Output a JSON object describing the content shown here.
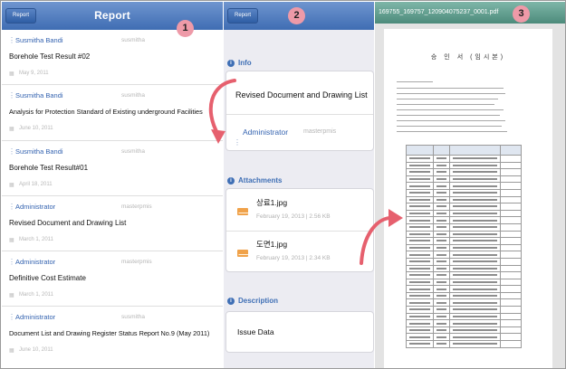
{
  "panel1": {
    "back_label": "Report",
    "title": "Report",
    "badge": "1",
    "items": [
      {
        "user": "Susmitha Bandi",
        "handle": "susmitha",
        "title": "Borehole Test Result #02",
        "date": "May 9, 2011"
      },
      {
        "user": "Susmitha Bandi",
        "handle": "susmitha",
        "title": "Analysis for Protection Standard of Existing underground Facilities",
        "date": "June 10, 2011"
      },
      {
        "user": "Susmitha Bandi",
        "handle": "susmitha",
        "title": "Borehole Test Result#01",
        "date": "April 18, 2011"
      },
      {
        "user": "Administrator",
        "handle": "masterpmis",
        "title": "Revised Document and Drawing List",
        "date": "March 1, 2011"
      },
      {
        "user": "Administrator",
        "handle": "masterpmis",
        "title": "Definitive Cost Estimate",
        "date": "March 1, 2011"
      },
      {
        "user": "Administrator",
        "handle": "susmitha",
        "title": "Document List and Drawing Register Status Report No.9 (May 2011)",
        "date": "June 10, 2011"
      }
    ]
  },
  "panel2": {
    "back_label": "Report",
    "badge": "2",
    "info_header": "Info",
    "doc_title": "Revised Document and Drawing List",
    "author": "Administrator",
    "author_handle": "masterpmis",
    "attachments_header": "Attachments",
    "attachments": [
      {
        "name": "상료1.jpg",
        "meta": "February 19, 2013 | 2.56 KB"
      },
      {
        "name": "도면1.jpg",
        "meta": "February 19, 2013 | 2.34 KB"
      }
    ],
    "description_header": "Description",
    "description": "Issue Data"
  },
  "panel3": {
    "filename": "169755_169757_120904075237_0001.pdf",
    "badge": "3",
    "doc_heading": "승 인 서 (임시본)"
  },
  "colors": {
    "nav_blue": "#4f7cc0",
    "link_blue": "#3463b0",
    "pdf_bar": "#5e9a8b",
    "badge": "#ee9aa8",
    "arrow": "#e6606e",
    "attachment_icon": "#f0a24a"
  }
}
